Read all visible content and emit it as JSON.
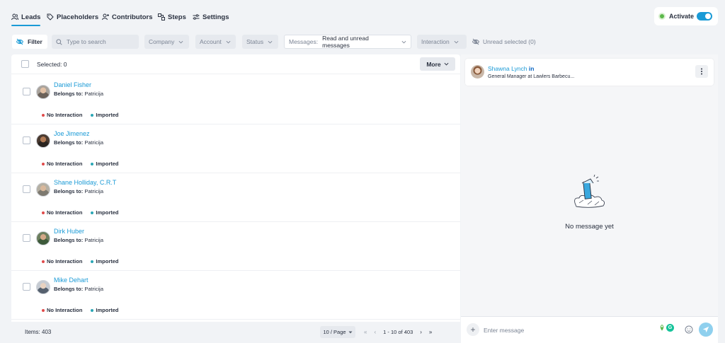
{
  "nav": {
    "tabs": [
      {
        "label": "Leads",
        "icon": "users-icon",
        "active": true
      },
      {
        "label": "Placeholders",
        "icon": "tag-icon",
        "active": false
      },
      {
        "label": "Contributors",
        "icon": "user-plus-icon",
        "active": false
      },
      {
        "label": "Steps",
        "icon": "steps-icon",
        "active": false
      },
      {
        "label": "Settings",
        "icon": "sliders-icon",
        "active": false
      }
    ],
    "activate_label": "Activate",
    "activate_on": true
  },
  "filters": {
    "filter_label": "Filter",
    "search_placeholder": "Type to search",
    "company": "Company",
    "account": "Account",
    "status": "Status",
    "messages_label": "Messages:",
    "messages_value": "Read and unread messages",
    "interaction": "Interaction",
    "unread_selected": "Unread selected (0)"
  },
  "list": {
    "selected_label": "Selected: 0",
    "more_label": "More",
    "leads": [
      {
        "name": "Daniel Fisher",
        "belongs_label": "Belongs to:",
        "owner": "Patricija",
        "interaction": "No Interaction",
        "source": "Imported"
      },
      {
        "name": "Joe Jimenez",
        "belongs_label": "Belongs to:",
        "owner": "Patricija",
        "interaction": "No Interaction",
        "source": "Imported"
      },
      {
        "name": "Shane Holliday, C.R.T",
        "belongs_label": "Belongs to:",
        "owner": "Patricija",
        "interaction": "No Interaction",
        "source": "Imported"
      },
      {
        "name": "Dirk Huber",
        "belongs_label": "Belongs to:",
        "owner": "Patricija",
        "interaction": "No Interaction",
        "source": "Imported"
      },
      {
        "name": "Mike Dehart",
        "belongs_label": "Belongs to:",
        "owner": "Patricija",
        "interaction": "No Interaction",
        "source": "Imported"
      }
    ]
  },
  "footer": {
    "items": "Items: 403",
    "per_page": "10 / Page",
    "range": "1 - 10 of 403"
  },
  "contact": {
    "name": "Shawna Lynch",
    "linkedin": "in",
    "title": "General Manager at Lawlers Barbecu..."
  },
  "chat": {
    "empty_text": "No message yet",
    "input_placeholder": "Enter message"
  },
  "colors": {
    "accent": "#1a9ad6",
    "no_interaction": "#e04b4b",
    "imported": "#2aa6b5",
    "active_green": "#5bb84a"
  }
}
